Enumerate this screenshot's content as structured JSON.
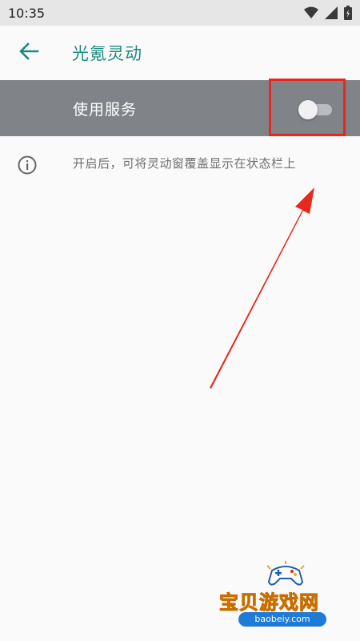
{
  "status_bar": {
    "time": "10:35",
    "icons": [
      "wifi-icon",
      "cellular-icon",
      "battery-icon"
    ]
  },
  "app_bar": {
    "back_icon": "back-arrow-icon",
    "title": "光氪灵动"
  },
  "service": {
    "label": "使用服务",
    "toggle_state": "off"
  },
  "info": {
    "icon": "info-icon",
    "text": "开启后，可将灵动窗覆盖显示在状态栏上"
  },
  "watermark": {
    "title": "宝贝游戏网",
    "url": "baobeiy.com"
  },
  "colors": {
    "accent": "#1b8a7e",
    "service_row_bg": "#808489",
    "annotation_red": "#e8281c",
    "background": "#fafafa"
  }
}
